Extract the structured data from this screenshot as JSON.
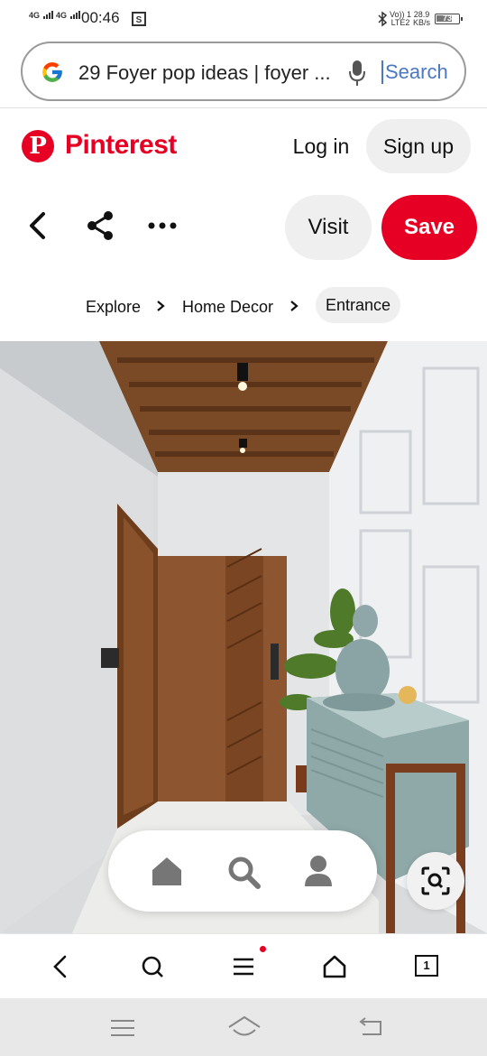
{
  "status_bar": {
    "network1": "4G",
    "network2": "4G",
    "time": "00:46",
    "volte": "Vo)) 1",
    "lte": "LTE2",
    "speed": "28.9",
    "speed_unit": "KB/s",
    "battery": "73",
    "battery_level": 0.73
  },
  "search": {
    "query": "29 Foyer pop ideas | foyer ...",
    "button_label": "Search"
  },
  "header": {
    "brand": "Pinterest",
    "login_label": "Log in",
    "signup_label": "Sign up"
  },
  "pin_actions": {
    "visit_label": "Visit",
    "save_label": "Save"
  },
  "breadcrumb": {
    "items": [
      "Explore",
      "Home Decor",
      "Entrance"
    ]
  },
  "browser_bar": {
    "tab_count": "1"
  },
  "colors": {
    "brand_red": "#e60023",
    "search_blue": "#4a78c2",
    "pill_gray": "#efefef"
  }
}
